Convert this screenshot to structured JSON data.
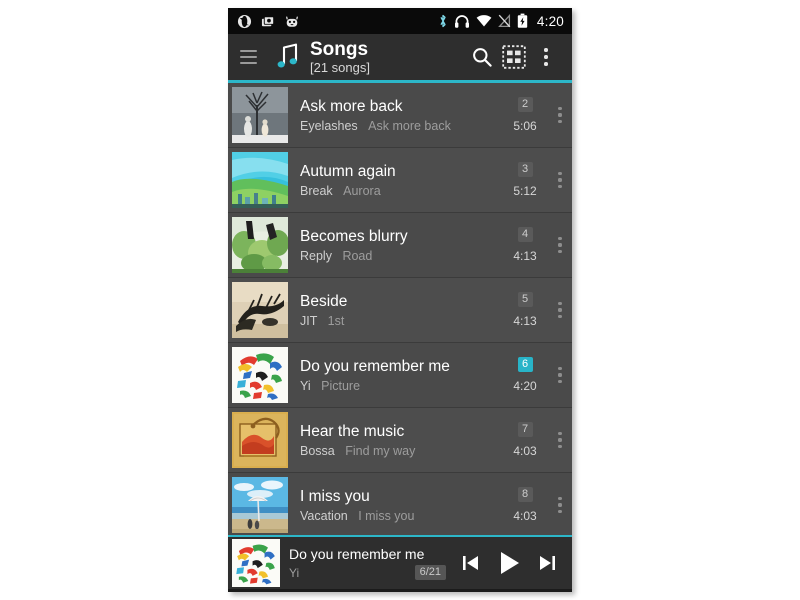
{
  "status_bar": {
    "icons_left": [
      "opera-icon",
      "screenshot-icon",
      "android-robot-icon"
    ],
    "icons_right": [
      "bluetooth-icon",
      "headset-icon",
      "wifi-icon",
      "signal-off-icon",
      "battery-charging-icon"
    ],
    "clock": "4:20"
  },
  "toolbar": {
    "menu_icon": "hamburger-menu-icon",
    "app_icon": "music-note-icon",
    "title": "Songs",
    "subtitle": "[21 songs]",
    "search_icon": "search-icon",
    "view_mode_icon": "grid-view-icon",
    "overflow_icon": "overflow-menu-icon"
  },
  "colors": {
    "accent": "#2cb7c9",
    "toolbar_bg": "#2e2e2e",
    "row_bg": "#4a4a4a",
    "status_bg": "#0a0a0a",
    "active_badge": "#28b4c8"
  },
  "songs": [
    {
      "title": "Ask more back",
      "artist": "Eyelashes",
      "album": "Ask more back",
      "track": "2",
      "duration": "5:06",
      "art": "tree-figures-grayscale",
      "active": false
    },
    {
      "title": "Autumn again",
      "artist": "Break",
      "album": "Aurora",
      "track": "3",
      "duration": "5:12",
      "art": "green-blue-landscape",
      "active": false
    },
    {
      "title": "Becomes blurry",
      "artist": "Reply",
      "album": "Road",
      "track": "4",
      "duration": "4:13",
      "art": "green-foliage",
      "active": false
    },
    {
      "title": "Beside",
      "artist": "JIT",
      "album": "1st",
      "track": "5",
      "duration": "4:13",
      "art": "dark-tree-beige",
      "active": false
    },
    {
      "title": "Do you remember me",
      "artist": "Yi",
      "album": "Picture",
      "track": "6",
      "duration": "4:20",
      "art": "colorful-paint-strokes",
      "active": true
    },
    {
      "title": "Hear the music",
      "artist": "Bossa",
      "album": "Find my way",
      "track": "7",
      "duration": "4:03",
      "art": "gold-abstract",
      "active": false
    },
    {
      "title": "I miss you",
      "artist": "Vacation",
      "album": "I miss you",
      "track": "8",
      "duration": "4:03",
      "art": "beach-parasol",
      "active": false
    }
  ],
  "player": {
    "title": "Do you remember me",
    "artist": "Yi",
    "counter": "6/21",
    "art": "colorful-paint-strokes",
    "previous_icon": "skip-previous-icon",
    "play_icon": "play-icon",
    "next_icon": "skip-next-icon"
  }
}
